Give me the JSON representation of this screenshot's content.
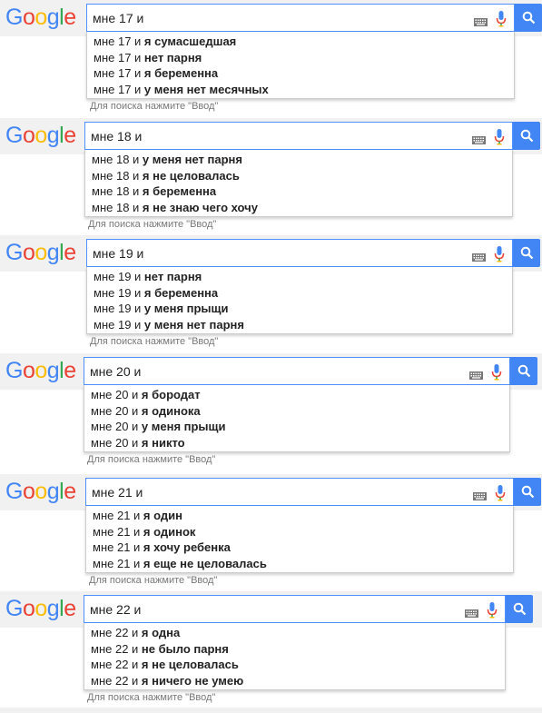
{
  "logo": [
    "G",
    "o",
    "o",
    "g",
    "l",
    "e"
  ],
  "logo_colors": [
    "#4285f4",
    "#ea4335",
    "#fbbc05",
    "#4285f4",
    "#34a853",
    "#ea4335"
  ],
  "hint_text": "Для поиска нажмите \"Ввод\"",
  "icons": {
    "keyboard": "keyboard-icon",
    "mic": "microphone-icon",
    "search": "magnifier-icon"
  },
  "panels": [
    {
      "query": "мне 17 и",
      "suggestions": [
        {
          "prefix": "мне 17 и ",
          "bold": "я сумасшедшая"
        },
        {
          "prefix": "мне 17 и ",
          "bold": "нет парня"
        },
        {
          "prefix": "мне 17 и ",
          "bold": "я беременна"
        },
        {
          "prefix": "мне 17 и ",
          "bold": "у меня нет месячных"
        }
      ]
    },
    {
      "query": "мне 18 и",
      "suggestions": [
        {
          "prefix": "мне 18 и ",
          "bold": "у меня нет парня"
        },
        {
          "prefix": "мне 18 и ",
          "bold": "я не целовалась"
        },
        {
          "prefix": "мне 18 и ",
          "bold": "я беременна"
        },
        {
          "prefix": "мне 18 и ",
          "bold": "я не знаю чего хочу"
        }
      ]
    },
    {
      "query": "мне 19 и",
      "suggestions": [
        {
          "prefix": "мне 19 и ",
          "bold": "нет парня"
        },
        {
          "prefix": "мне 19 и ",
          "bold": "я беременна"
        },
        {
          "prefix": "мне 19 и ",
          "bold": "у меня прыщи"
        },
        {
          "prefix": "мне 19 и ",
          "bold": "у меня нет парня"
        }
      ]
    },
    {
      "query": "мне 20 и",
      "suggestions": [
        {
          "prefix": "мне 20 и ",
          "bold": "я бородат"
        },
        {
          "prefix": "мне 20 и ",
          "bold": "я одинока"
        },
        {
          "prefix": "мне 20 и ",
          "bold": "у меня прыщи"
        },
        {
          "prefix": "мне 20 и ",
          "bold": "я никто"
        }
      ]
    },
    {
      "query": "мне 21 и",
      "suggestions": [
        {
          "prefix": "мне 21 и ",
          "bold": "я один"
        },
        {
          "prefix": "мне 21 и ",
          "bold": "я одинок"
        },
        {
          "prefix": "мне 21 и ",
          "bold": "я хочу ребенка"
        },
        {
          "prefix": "мне 21 и ",
          "bold": "я еще не целовалась"
        }
      ]
    },
    {
      "query": "мне 22 и",
      "suggestions": [
        {
          "prefix": "мне 22 и ",
          "bold": "я одна"
        },
        {
          "prefix": "мне 22 и ",
          "bold": "не было парня"
        },
        {
          "prefix": "мне 22 и ",
          "bold": "я не целовалась"
        },
        {
          "prefix": "мне 22 и ",
          "bold": "я ничего не умею"
        }
      ]
    }
  ]
}
